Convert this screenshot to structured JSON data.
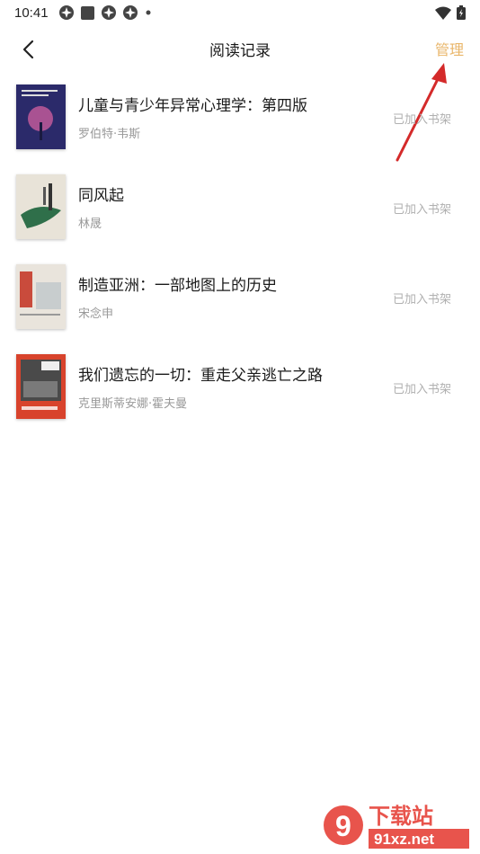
{
  "status_bar": {
    "time": "10:41",
    "icons": [
      "pinwheel-icon",
      "square-app-icon",
      "pinwheel-icon",
      "pinwheel-icon",
      "dot-icon",
      "wifi-icon",
      "battery-icon"
    ]
  },
  "nav": {
    "title": "阅读记录",
    "manage_label": "管理",
    "back_icon": "chevron-left-icon",
    "accent_color": "#e9b66a"
  },
  "books": [
    {
      "title": "儿童与青少年异常心理学：第四版",
      "author": "罗伯特·韦斯",
      "status": "已加入书架",
      "cover_color": "#2b2a6a"
    },
    {
      "title": "同风起",
      "author": "林晟",
      "status": "已加入书架",
      "cover_color": "#e8e3d8"
    },
    {
      "title": "制造亚洲：一部地图上的历史",
      "author": "宋念申",
      "status": "已加入书架",
      "cover_color": "#e9e4dc"
    },
    {
      "title": "我们遗忘的一切：重走父亲逃亡之路",
      "author": "克里斯蒂安娜·霍夫曼",
      "status": "已加入书架",
      "cover_color": "#d8432c"
    }
  ],
  "annotation": {
    "arrow_color": "#d42a2a"
  },
  "watermark": {
    "domain": "91xz.net",
    "label": "下载站",
    "brand": "9"
  }
}
